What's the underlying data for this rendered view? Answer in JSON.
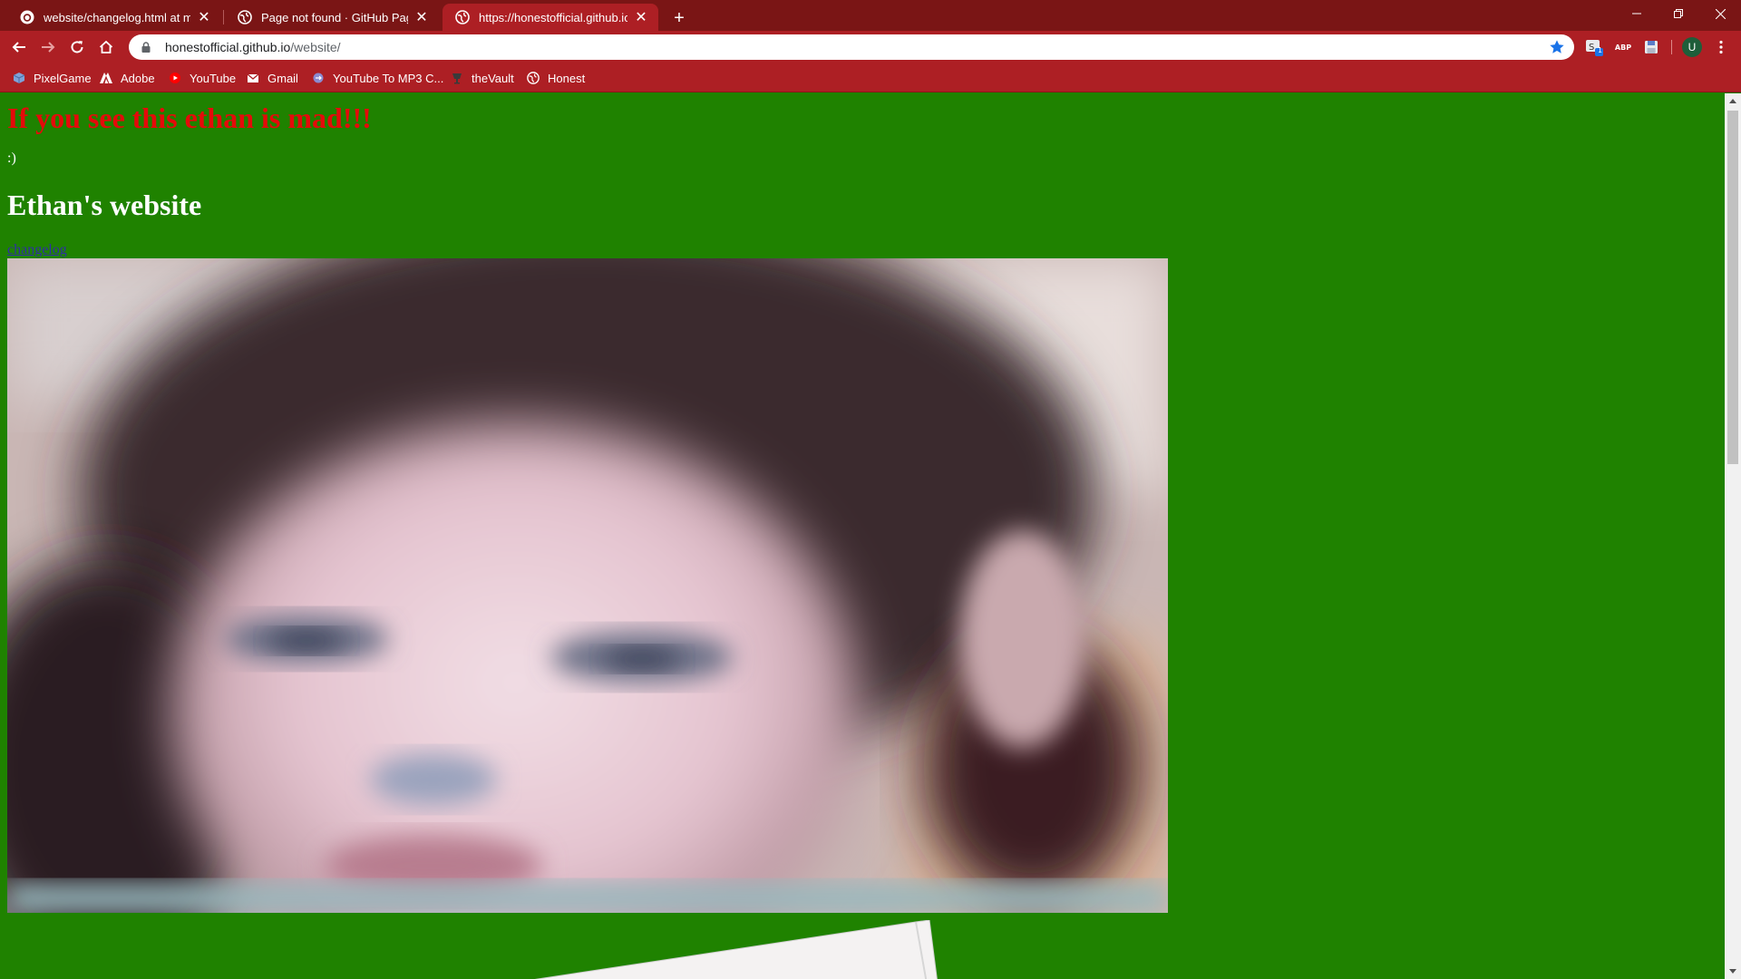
{
  "browser": {
    "tabs": [
      {
        "title": "website/changelog.html at maste",
        "icon": "github-icon",
        "active": false
      },
      {
        "title": "Page not found · GitHub Pages",
        "icon": "globe-icon",
        "active": false
      },
      {
        "title": "https://honestofficial.github.io/w",
        "icon": "globe-icon",
        "active": true
      }
    ],
    "new_tab_label": "+",
    "address": {
      "host": "honestofficial.github.io",
      "path": "/website/"
    },
    "profile_initial": "U",
    "extension_badge": "1",
    "adblock_label": "ABP",
    "accent_color": "#ad1f24",
    "tabstrip_color": "#7a1515"
  },
  "bookmarks": [
    {
      "label": "PixelGame",
      "icon": "cube-icon"
    },
    {
      "label": "Adobe",
      "icon": "adobe-icon"
    },
    {
      "label": "YouTube",
      "icon": "youtube-icon"
    },
    {
      "label": "Gmail",
      "icon": "gmail-icon"
    },
    {
      "label": "YouTube To MP3 C...",
      "icon": "converter-icon"
    },
    {
      "label": "theVault",
      "icon": "vault-icon"
    },
    {
      "label": "Honest",
      "icon": "globe-icon"
    }
  ],
  "page": {
    "alert_heading": "If you see this ethan is mad!!!",
    "smiley": ":)",
    "site_title": "Ethan's website",
    "changelog_link": "changelog",
    "background_color": "#1f8200",
    "alert_color": "#e50a0a"
  }
}
